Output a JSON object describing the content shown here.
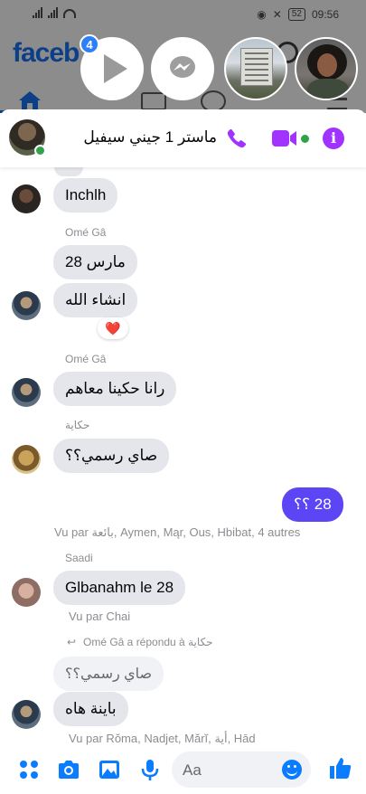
{
  "status_bar": {
    "time": "09:56",
    "battery": "52"
  },
  "facebook": {
    "logo_text": "faceb"
  },
  "chat_heads": {
    "badge_count": "4"
  },
  "header": {
    "title": "ماستر 1 جيني سيفيل"
  },
  "colors": {
    "accent": "#a033ff",
    "outgoing": "#5c45f5",
    "incoming": "#e4e6eb",
    "link_blue": "#0a7cff"
  },
  "messages": {
    "m1": {
      "text": "Inchlh"
    },
    "s2": {
      "sender": "Omé Gâ"
    },
    "m2": {
      "text": "28 مارس"
    },
    "m3": {
      "text": "انشاء الله",
      "reaction": "❤️"
    },
    "s4": {
      "sender": "Omé Gâ"
    },
    "m4": {
      "text": "رانا حكينا معاهم"
    },
    "s5": {
      "sender": "حكاية"
    },
    "m5": {
      "text": "صاي رسمي؟؟"
    },
    "m6": {
      "text": "28 ؟؟"
    },
    "seen1": "Vu par بائعة, Aymen, Mąr, Ous, Hbibat, 4 autres",
    "s7": {
      "sender": "Saadi"
    },
    "m7": {
      "text": "Glbanahm le 28"
    },
    "seen2": "Vu par Chai",
    "reply_indicator": "Omé Gâ a répondu à حكاية",
    "quoted": "صاي رسمي؟؟",
    "m8": {
      "text": "باينة هاه"
    },
    "seen3": "Vu par Rŏma, Nadjet, Mărĭ, أية, Hād"
  },
  "composer": {
    "placeholder": "Aa"
  }
}
